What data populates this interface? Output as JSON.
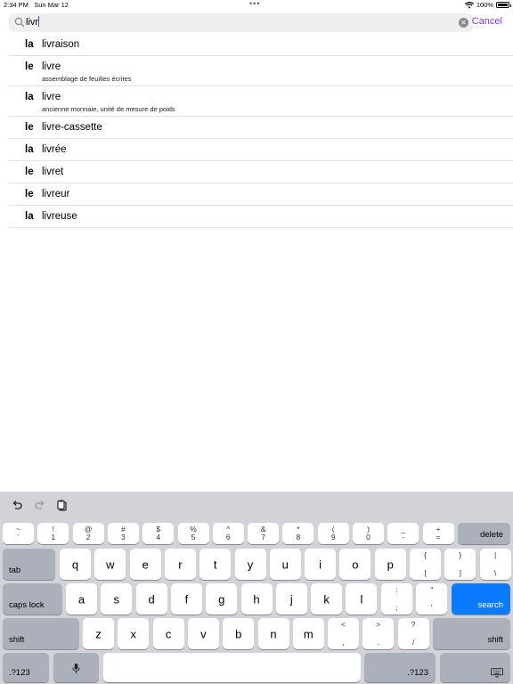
{
  "status_bar": {
    "time": "2:34 PM",
    "date": "Sun Mar 12",
    "battery": "100%",
    "battery_level": 1.0
  },
  "search": {
    "query": "livr",
    "cancel_label": "Cancel"
  },
  "results": [
    {
      "article": "la",
      "word": "livraison",
      "definition": ""
    },
    {
      "article": "le",
      "word": "livre",
      "definition": "assemblage de feuilles écrites"
    },
    {
      "article": "la",
      "word": "livre",
      "definition": "ancienne monnaie, unité de mesure de poids"
    },
    {
      "article": "le",
      "word": "livre-cassette",
      "definition": ""
    },
    {
      "article": "la",
      "word": "livrée",
      "definition": ""
    },
    {
      "article": "le",
      "word": "livret",
      "definition": ""
    },
    {
      "article": "le",
      "word": "livreur",
      "definition": ""
    },
    {
      "article": "la",
      "word": "livreuse",
      "definition": ""
    }
  ],
  "keyboard": {
    "number_row": [
      {
        "top": "~",
        "bottom": "`"
      },
      {
        "top": "!",
        "bottom": "1"
      },
      {
        "top": "@",
        "bottom": "2"
      },
      {
        "top": "#",
        "bottom": "3"
      },
      {
        "top": "$",
        "bottom": "4"
      },
      {
        "top": "%",
        "bottom": "5"
      },
      {
        "top": "^",
        "bottom": "6"
      },
      {
        "top": "&",
        "bottom": "7"
      },
      {
        "top": "*",
        "bottom": "8"
      },
      {
        "top": "(",
        "bottom": "9"
      },
      {
        "top": ")",
        "bottom": "0"
      },
      {
        "top": "_",
        "bottom": "-"
      },
      {
        "top": "+",
        "bottom": "="
      }
    ],
    "delete_label": "delete",
    "tab_label": "tab",
    "row_q": [
      "q",
      "w",
      "e",
      "r",
      "t",
      "y",
      "u",
      "i",
      "o",
      "p"
    ],
    "row_q_extra": [
      {
        "top": "{",
        "bottom": "["
      },
      {
        "top": "}",
        "bottom": "]"
      },
      {
        "top": "|",
        "bottom": "\\"
      }
    ],
    "caps_label": "caps lock",
    "row_a": [
      "a",
      "s",
      "d",
      "f",
      "g",
      "h",
      "j",
      "k",
      "l"
    ],
    "row_a_extra": [
      {
        "top": ":",
        "bottom": ";"
      },
      {
        "top": "\"",
        "bottom": "'"
      }
    ],
    "search_label": "search",
    "shift_label": "shift",
    "row_z": [
      "z",
      "x",
      "c",
      "v",
      "b",
      "n",
      "m"
    ],
    "row_z_extra": [
      {
        "top": "<",
        "bottom": ","
      },
      {
        "top": ">",
        "bottom": "."
      },
      {
        "top": "?",
        "bottom": "/"
      }
    ],
    "numbers_label": ".?123",
    "accent_color": "#0a7aff"
  }
}
